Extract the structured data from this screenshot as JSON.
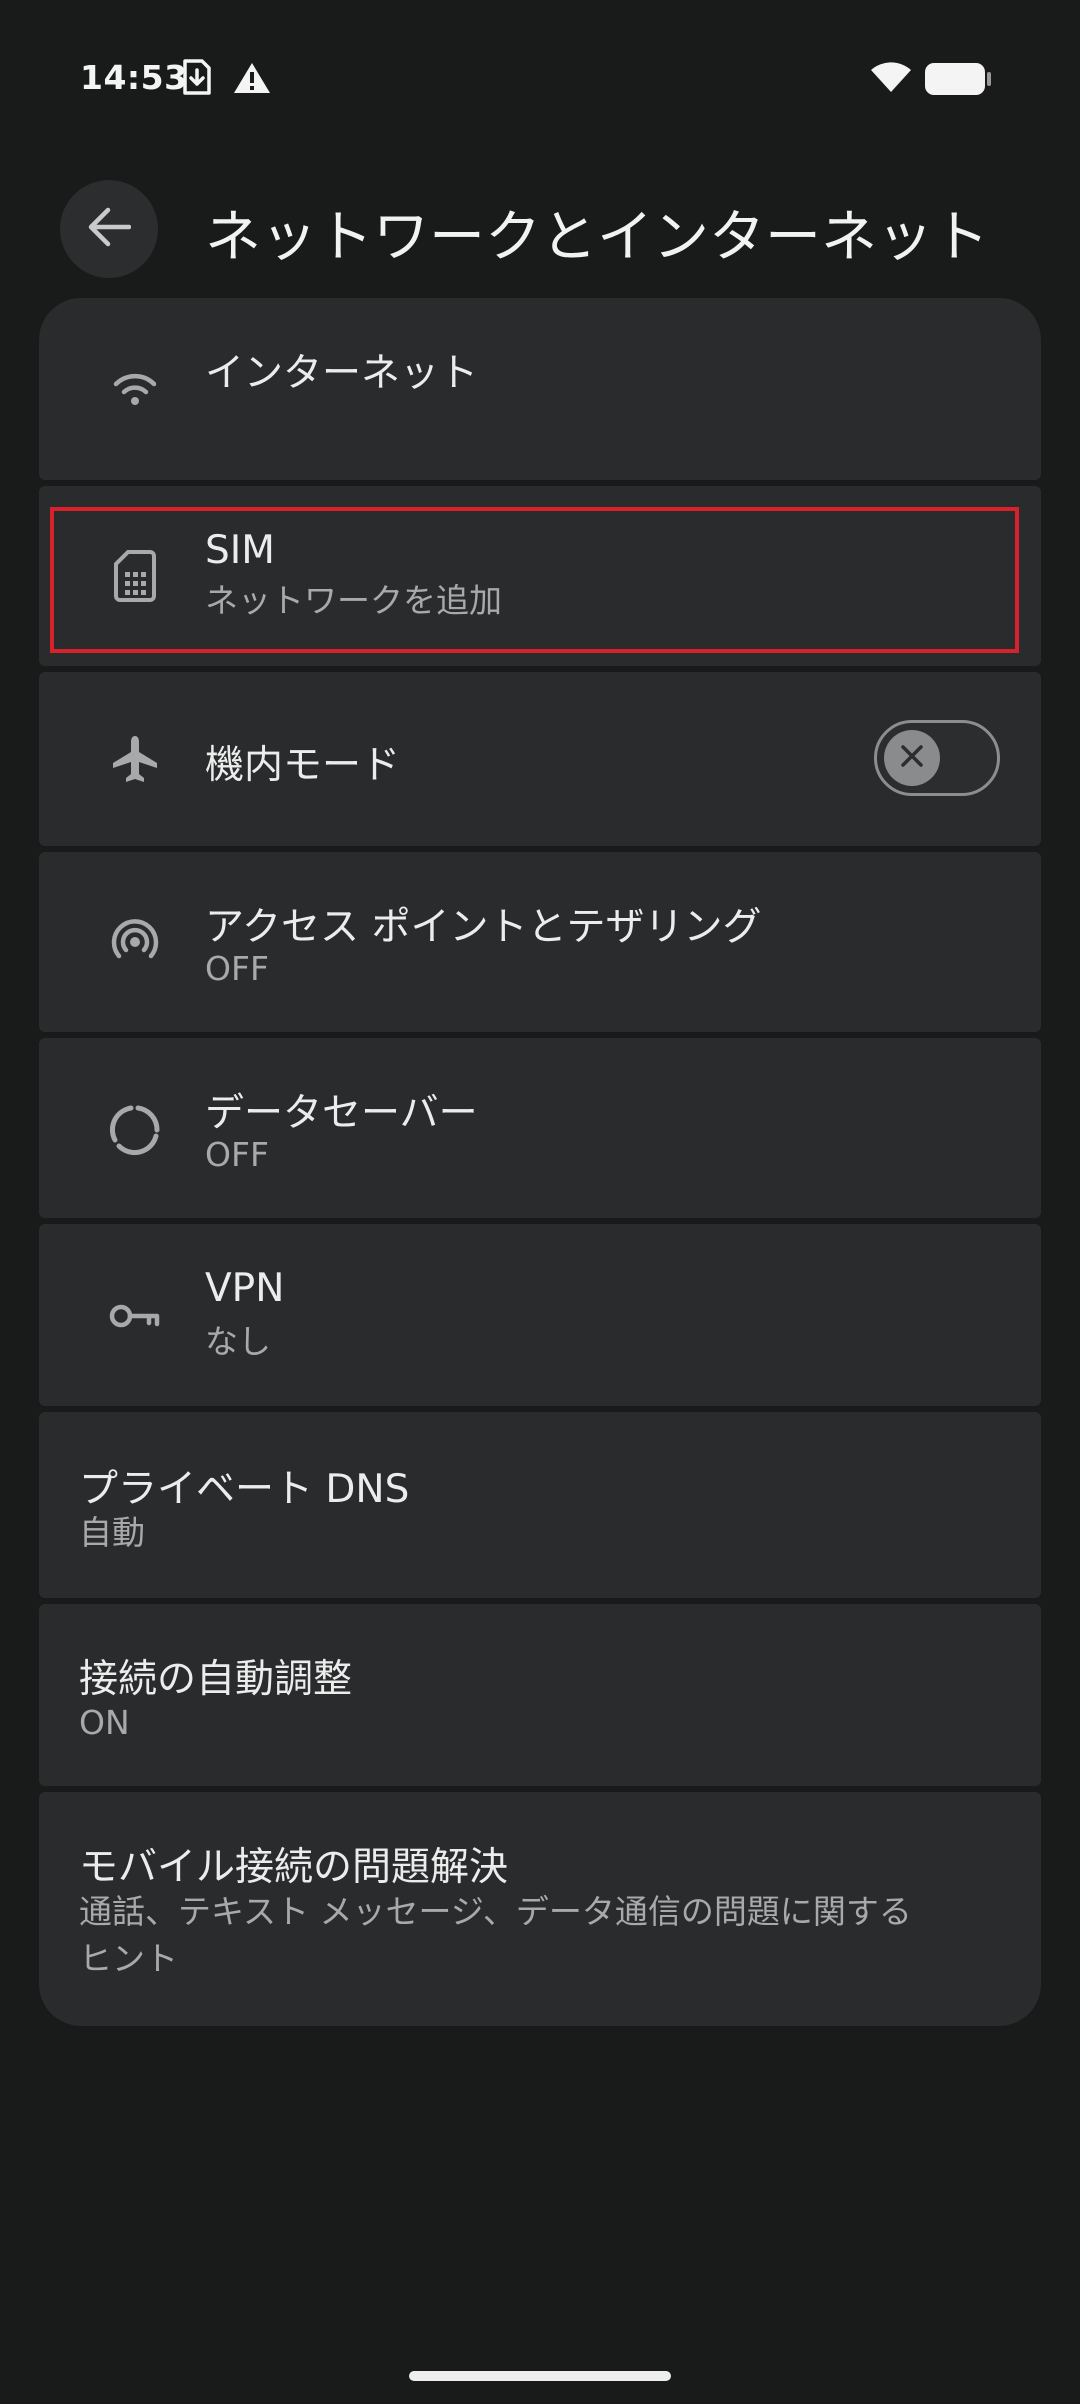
{
  "status_bar": {
    "time": "14:53",
    "icons": [
      "sim-download-icon",
      "alert-triangle-icon",
      "wifi-icon",
      "battery-icon"
    ]
  },
  "header": {
    "back_icon": "arrow-left-icon",
    "title": "ネットワークとインターネット"
  },
  "items": {
    "internet": {
      "icon": "wifi-icon",
      "title": "インターネット"
    },
    "sim": {
      "icon": "sim-card-icon",
      "title": "SIM",
      "summary": "ネットワークを追加"
    },
    "airplane": {
      "icon": "airplane-icon",
      "title": "機内モード",
      "toggle_state": "off"
    },
    "hotspot": {
      "icon": "hotspot-icon",
      "title": "アクセス ポイントとテザリング",
      "summary": "OFF"
    },
    "data_saver": {
      "icon": "data-saver-icon",
      "title": "データセーバー",
      "summary": "OFF"
    },
    "vpn": {
      "icon": "vpn-key-icon",
      "title": "VPN",
      "summary": "なし"
    },
    "private_dns": {
      "title": "プライベート DNS",
      "summary": "自動"
    },
    "adaptive": {
      "title": "接続の自動調整",
      "summary": "ON"
    },
    "troubleshoot": {
      "title": "モバイル接続の問題解決",
      "summary_line1": "通話、テキスト メッセージ、データ通信の問題に関する",
      "summary_line2": "ヒント"
    }
  },
  "colors": {
    "background": "#191a1a",
    "card": "#292b2c",
    "highlight": "#d8222b",
    "secondary_text": "#a7a9aa"
  }
}
